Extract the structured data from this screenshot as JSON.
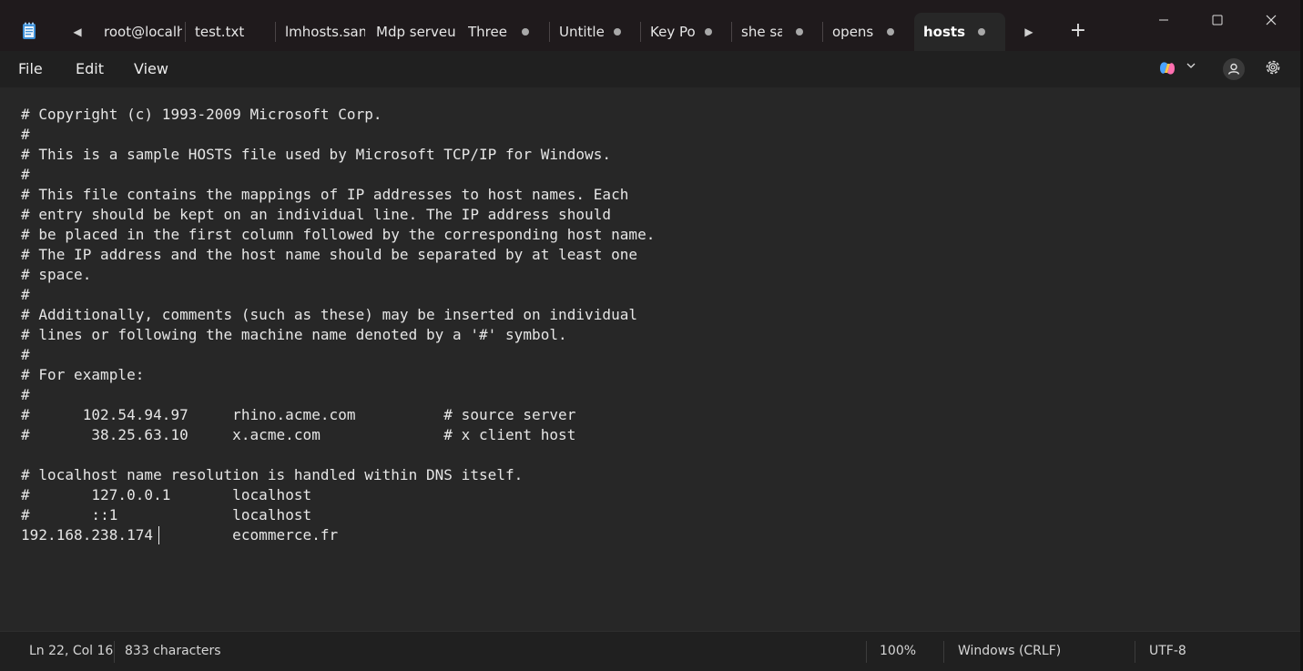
{
  "window": {
    "app_icon": "notepad-icon",
    "tabs": [
      {
        "label": "root@localh",
        "active": false,
        "modified": false
      },
      {
        "label": "test.txt",
        "active": false,
        "modified": false
      },
      {
        "label": "lmhosts.sam",
        "active": false,
        "modified": false
      },
      {
        "label": "Mdp serveur",
        "active": false,
        "modified": false
      },
      {
        "label": "Three",
        "active": false,
        "modified": true
      },
      {
        "label": "Untitle",
        "active": false,
        "modified": true
      },
      {
        "label": "Key Po",
        "active": false,
        "modified": true
      },
      {
        "label": "she sai",
        "active": false,
        "modified": true
      },
      {
        "label": "openss",
        "active": false,
        "modified": true
      },
      {
        "label": "hosts",
        "active": true,
        "modified": true
      }
    ],
    "icons": {
      "scroll_left": "caret-left-icon",
      "scroll_right": "caret-right-icon",
      "new_tab": "plus-icon",
      "minimize": "minimize-icon",
      "maximize": "maximize-icon",
      "close": "close-icon",
      "copilot": "copilot-icon",
      "account": "account-icon",
      "settings": "gear-icon"
    }
  },
  "menu": {
    "file": "File",
    "edit": "Edit",
    "view": "View"
  },
  "editor": {
    "lines": [
      "# Copyright (c) 1993-2009 Microsoft Corp.",
      "#",
      "# This is a sample HOSTS file used by Microsoft TCP/IP for Windows.",
      "#",
      "# This file contains the mappings of IP addresses to host names. Each",
      "# entry should be kept on an individual line. The IP address should",
      "# be placed in the first column followed by the corresponding host name.",
      "# The IP address and the host name should be separated by at least one",
      "# space.",
      "#",
      "# Additionally, comments (such as these) may be inserted on individual",
      "# lines or following the machine name denoted by a '#' symbol.",
      "#",
      "# For example:",
      "#",
      "#      102.54.94.97     rhino.acme.com          # source server",
      "#       38.25.63.10     x.acme.com              # x client host",
      "",
      "# localhost name resolution is handled within DNS itself.",
      "#\t127.0.0.1       localhost",
      "#\t::1             localhost",
      "192.168.238.174         ecommerce.fr"
    ]
  },
  "status": {
    "position": "Ln 22, Col 16",
    "characters": "833 characters",
    "zoom": "100%",
    "line_ending": "Windows (CRLF)",
    "encoding": "UTF-8"
  },
  "colors": {
    "titlebar": "#1f1a1c",
    "editor_bg": "#272727",
    "text": "#e6e6e6",
    "spellcheck_underline": "#e0424b"
  }
}
